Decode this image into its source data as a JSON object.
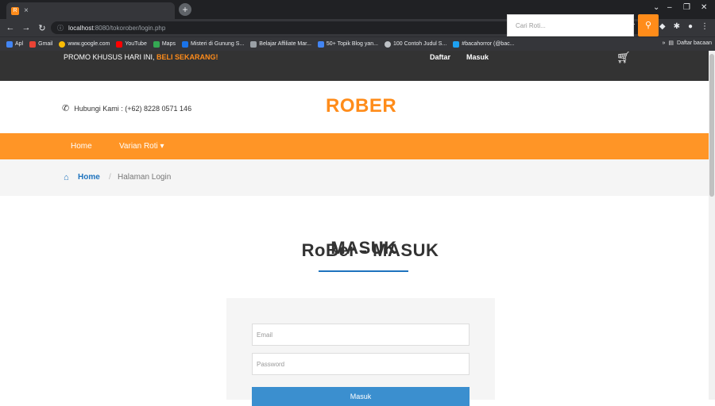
{
  "browser": {
    "tab_title": "RoBer - MASUK",
    "tab_close": "×",
    "new_tab": "+",
    "url_host": "localhost",
    "url_rest": ":8080/tokorober/login.php",
    "window_controls": [
      "⌄",
      "–",
      "❐",
      "✕"
    ],
    "bookmarks": [
      {
        "label": "Apl",
        "color": "#4285f4"
      },
      {
        "label": "Gmail",
        "color": "#ea4335"
      },
      {
        "label": "www.google.com",
        "color": "#fbbc05"
      },
      {
        "label": "YouTube",
        "color": "#ff0000"
      },
      {
        "label": "Maps",
        "color": "#34a853"
      },
      {
        "label": "Misteri di Gunung S...",
        "color": "#1a73e8"
      },
      {
        "label": "Belajar Affiliate Mar...",
        "color": "#9aa0a6"
      },
      {
        "label": "50+ Topik Blog yan...",
        "color": "#4285f4"
      },
      {
        "label": "100 Contoh Judul S...",
        "color": "#bdc1c6"
      },
      {
        "label": "#bacahorror (@bac...",
        "color": "#1da1f2"
      }
    ],
    "bookmarks_more": "»",
    "reading_list": "Daftar bacaan"
  },
  "promo": {
    "text": "PROMO KHUSUS HARI INI, ",
    "emphasis": "BELI SEKARANG!",
    "daftar": "Daftar",
    "masuk": "Masuk"
  },
  "header": {
    "contact": "Hubungi Kami : (+62) 8228 0571 146",
    "brand": "ROBER",
    "search_placeholder": "Cari Roti..."
  },
  "nav": {
    "home": "Home",
    "varian": "Varian Roti ▾"
  },
  "breadcrumb": {
    "home": "Home",
    "separator": "/",
    "current": "Halaman Login"
  },
  "login": {
    "title": "MASUK",
    "email_placeholder": "Email",
    "password_placeholder": "Password",
    "submit": "Masuk"
  },
  "colors": {
    "accent": "#ff9526",
    "brand": "#ff8c1a",
    "link": "#1e73be",
    "button": "#3b8fcf"
  }
}
